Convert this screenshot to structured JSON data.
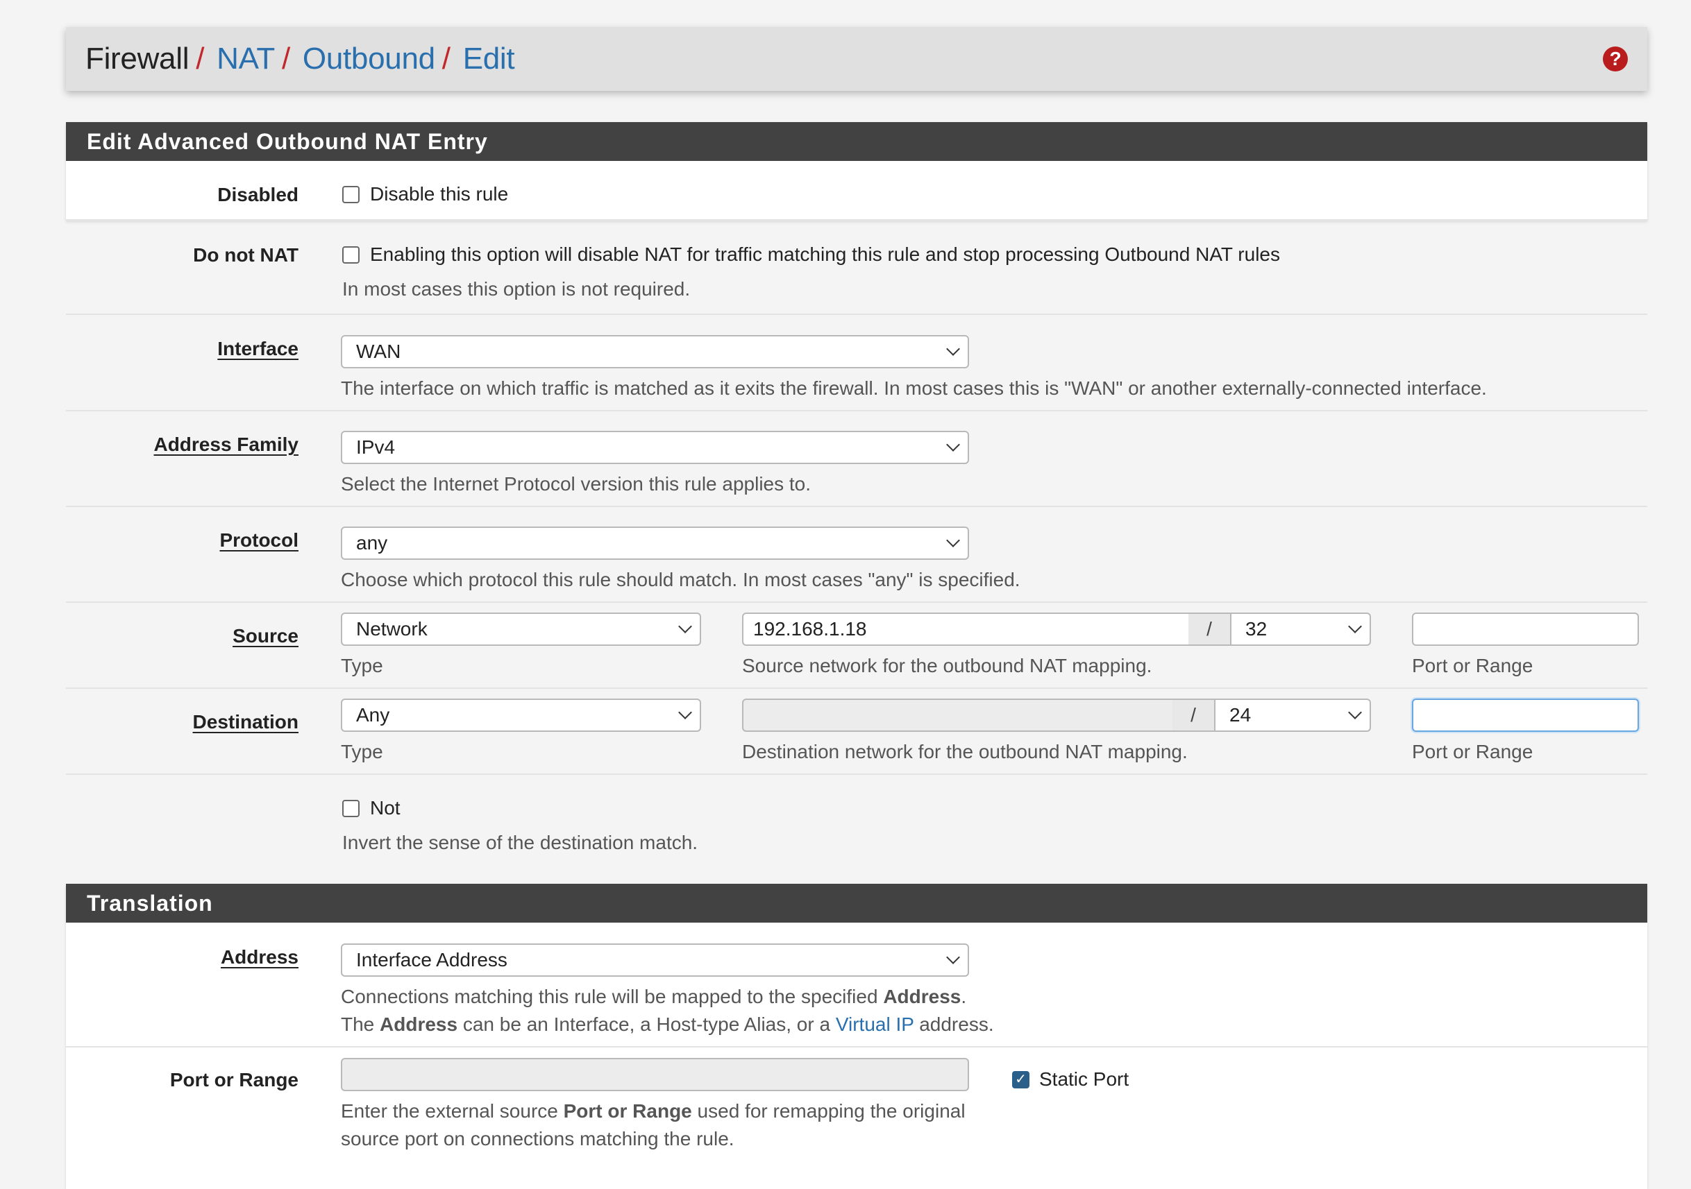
{
  "breadcrumb": {
    "items": [
      "Firewall",
      "NAT",
      "Outbound",
      "Edit"
    ],
    "separator": "/"
  },
  "panel_main": {
    "title": "Edit Advanced Outbound NAT Entry",
    "disabled": {
      "label": "Disabled",
      "checkbox_text": "Disable this rule",
      "checked": false
    },
    "do_not_nat": {
      "label": "Do not NAT",
      "checkbox_text": "Enabling this option will disable NAT for traffic matching this rule and stop processing Outbound NAT rules",
      "hint": "In most cases this option is not required.",
      "checked": false
    },
    "interface": {
      "label": "Interface",
      "value": "WAN",
      "hint": "The interface on which traffic is matched as it exits the firewall. In most cases this is \"WAN\" or another externally-connected interface."
    },
    "address_family": {
      "label": "Address Family",
      "value": "IPv4",
      "hint": "Select the Internet Protocol version this rule applies to."
    },
    "protocol": {
      "label": "Protocol",
      "value": "any",
      "hint": "Choose which protocol this rule should match. In most cases \"any\" is specified."
    },
    "source": {
      "label": "Source",
      "type_value": "Network",
      "type_hint": "Type",
      "network_value": "192.168.1.18",
      "slash": "/",
      "mask_value": "32",
      "network_hint": "Source network for the outbound NAT mapping.",
      "port_value": "",
      "port_hint": "Port or Range"
    },
    "destination": {
      "label": "Destination",
      "type_value": "Any",
      "type_hint": "Type",
      "network_value": "",
      "slash": "/",
      "mask_value": "24",
      "network_hint": "Destination network for the outbound NAT mapping.",
      "port_value": "",
      "port_hint": "Port or Range"
    },
    "not": {
      "checkbox_text": "Not",
      "hint": "Invert the sense of the destination match.",
      "checked": false
    }
  },
  "panel_translation": {
    "title": "Translation",
    "address": {
      "label": "Address",
      "value": "Interface Address",
      "hint1_pre": "Connections matching this rule will be mapped to the specified ",
      "hint1_bold": "Address",
      "hint1_post": ".",
      "hint2_pre": "The ",
      "hint2_bold": "Address",
      "hint2_mid": " can be an Interface, a Host-type Alias, or a ",
      "hint2_link": "Virtual IP",
      "hint2_post": " address."
    },
    "port_or_range": {
      "label": "Port or Range",
      "value": "",
      "static_port_text": "Static Port",
      "static_port_checked": true,
      "hint1_pre": "Enter the external source ",
      "hint1_bold": "Port or Range",
      "hint1_post": " used for remapping the original",
      "hint2": "source port on connections matching the rule."
    }
  },
  "icons": {
    "help": "question-circle-icon",
    "chevron": "chevron-down-icon",
    "check": "check-icon"
  },
  "colors": {
    "link": "#2a6fad",
    "separator": "#c0282c",
    "heading_bg": "#424242",
    "help": "#b91c1c"
  }
}
